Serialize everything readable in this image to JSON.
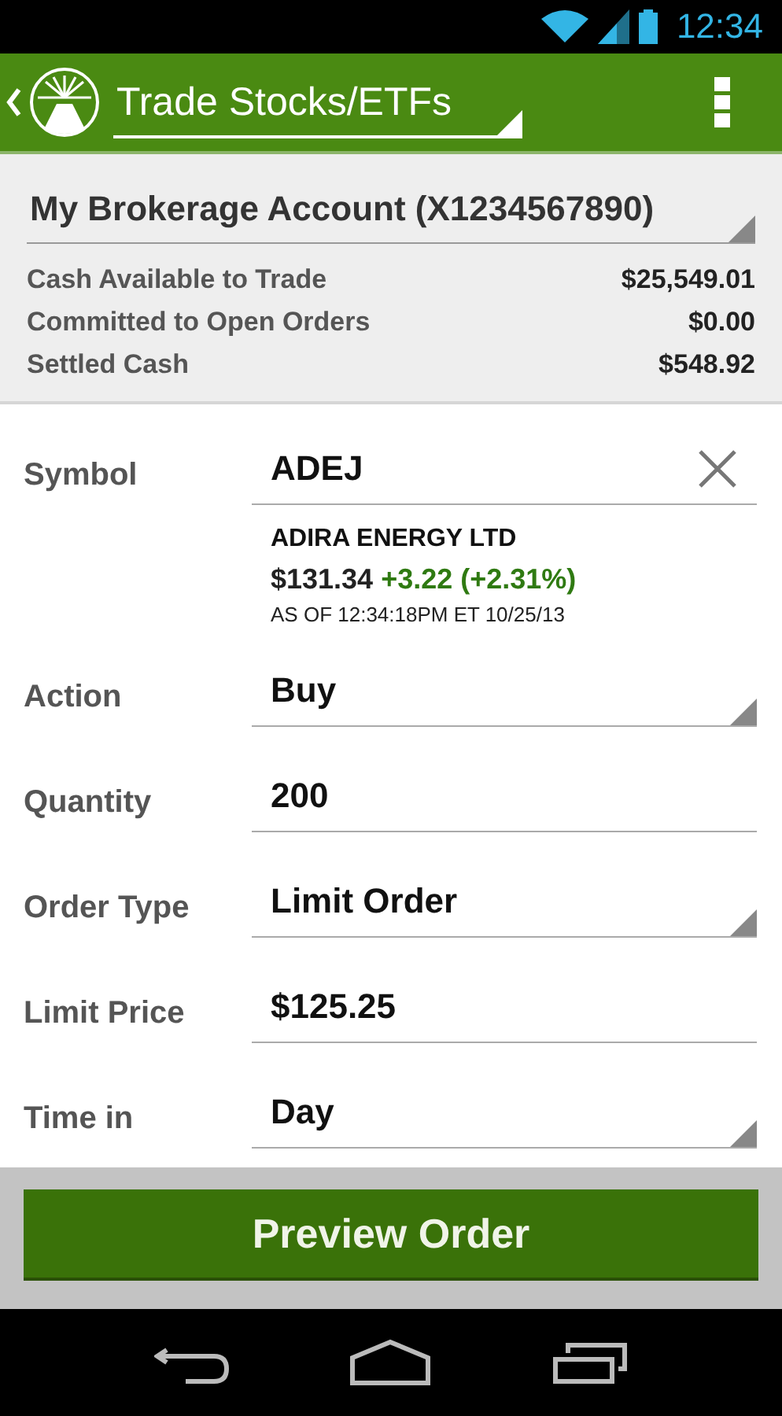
{
  "status_bar": {
    "time": "12:34"
  },
  "app_bar": {
    "title": "Trade Stocks/ETFs"
  },
  "account": {
    "name": "My Brokerage Account (X1234567890)",
    "balances": [
      {
        "label": "Cash Available to Trade",
        "value": "$25,549.01"
      },
      {
        "label": "Committed to Open Orders",
        "value": "$0.00"
      },
      {
        "label": "Settled Cash",
        "value": "$548.92"
      }
    ]
  },
  "form": {
    "fields": [
      {
        "label": "Symbol",
        "kind": "text",
        "value": "ADEJ",
        "clearable": true,
        "quote": {
          "name": "ADIRA ENERGY LTD",
          "price": "$131.34",
          "change": "+3.22 (+2.31%)",
          "as_of": "AS OF 12:34:18PM ET 10/25/13"
        }
      },
      {
        "label": "Action",
        "kind": "dropdown",
        "value": "Buy"
      },
      {
        "label": "Quantity",
        "kind": "text",
        "value": "200",
        "clearable": false
      },
      {
        "label": "Order Type",
        "kind": "dropdown",
        "value": "Limit Order"
      },
      {
        "label": "Limit Price",
        "kind": "text",
        "value": "$125.25",
        "clearable": false
      },
      {
        "label": "Time in",
        "kind": "dropdown",
        "value": "Day"
      }
    ]
  },
  "primary_button": "Preview Order"
}
